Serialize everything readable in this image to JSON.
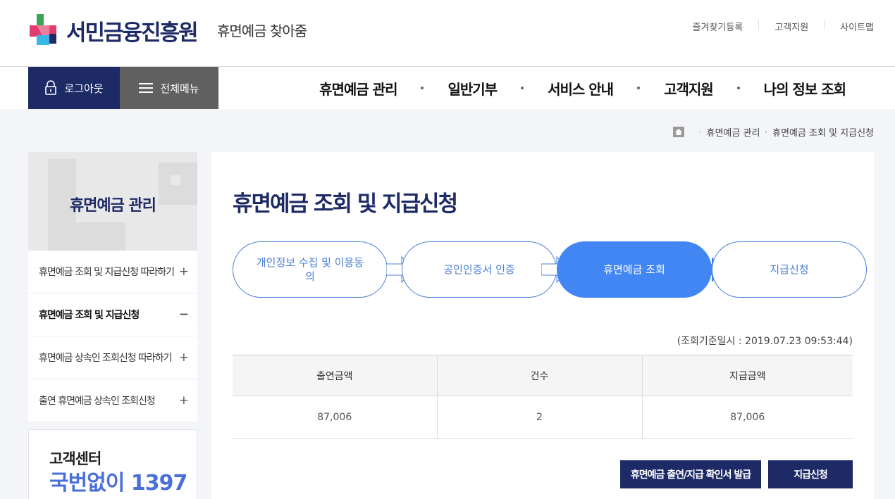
{
  "header": {
    "logo_text": "서민금융진흥원",
    "service_name": "휴면예금 찾아줌",
    "util_links": [
      "즐겨찾기등록",
      "고객지원",
      "사이트맵"
    ]
  },
  "gnb": {
    "logout_label": "로그아웃",
    "allmenu_label": "전체메뉴",
    "nav": [
      "휴면예금 관리",
      "일반기부",
      "서비스 안내",
      "고객지원",
      "나의 정보 조회"
    ]
  },
  "breadcrumb": [
    "휴면예금 관리",
    "휴면예금 조회 및 지급신청"
  ],
  "sidebar": {
    "title": "휴면예금 관리",
    "items": [
      {
        "label": "휴면예금 조회 및 지급신청 따라하기",
        "sign": "+"
      },
      {
        "label": "휴면예금 조회 및 지급신청",
        "sign": "−"
      },
      {
        "label": "휴면예금 상속인 조회신청 따라하기",
        "sign": "+"
      },
      {
        "label": "출연 휴면예금 상속인 조회신청",
        "sign": "+"
      }
    ],
    "cs_title": "고객센터",
    "cs_number": "국번없이 1397"
  },
  "main": {
    "title": "휴면예금 조회 및 지급신청",
    "steps": [
      "개인정보 수집 및 이용동의",
      "공인인증서 인증",
      "휴면예금 조회",
      "지급신청"
    ],
    "active_step": 2,
    "base_date": "(조회기준일시 : 2019.07.23 09:53:44)",
    "table": {
      "headers": [
        "출연금액",
        "건수",
        "지급금액"
      ],
      "rows": [
        [
          "87,006",
          "2",
          "87,006"
        ]
      ]
    },
    "buttons": {
      "confirm": "휴면예금 출연/지급 확인서 발급",
      "apply": "지급신청"
    }
  },
  "colors": {
    "navy": "#1e2a66",
    "accent_blue": "#4286f4",
    "step_border": "#4b7fd6"
  }
}
